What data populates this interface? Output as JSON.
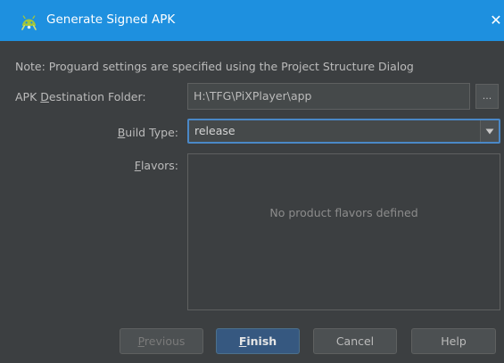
{
  "window": {
    "title": "Generate Signed APK",
    "close_glyph": "✕",
    "app_icon": "android-icon"
  },
  "note": "Note: Proguard settings are specified using the Project Structure Dialog",
  "destination": {
    "label_pre": "APK ",
    "label_mnemonic": "D",
    "label_post": "estination Folder:",
    "value": "H:\\TFG\\PiXPlayer\\app",
    "browse_label": "..."
  },
  "build_type": {
    "label_mnemonic": "B",
    "label_post": "uild Type:",
    "selected": "release",
    "arrow_icon": "triangle-down-icon"
  },
  "flavors": {
    "label_mnemonic": "F",
    "label_post": "lavors:",
    "empty_text": "No product flavors defined"
  },
  "buttons": {
    "previous_mnemonic": "P",
    "previous_rest": "revious",
    "finish_mnemonic": "F",
    "finish_rest": "inish",
    "cancel": "Cancel",
    "help": "Help"
  },
  "colors": {
    "titlebar": "#1e90df",
    "background": "#3c3f41",
    "focus_border": "#4a88c7",
    "primary_button": "#365880"
  }
}
